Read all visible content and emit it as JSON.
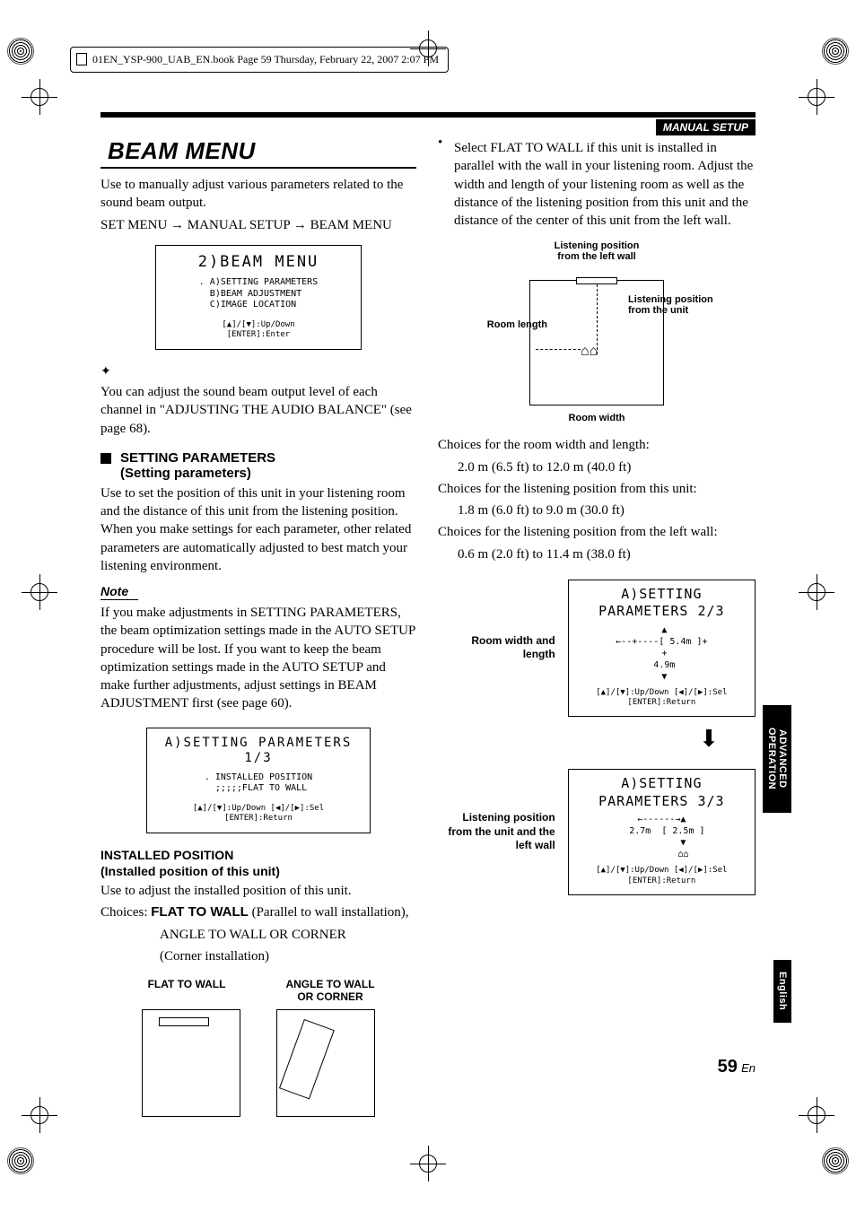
{
  "crop_header": "01EN_YSP-900_UAB_EN.book  Page 59  Thursday, February 22, 2007  2:07 PM",
  "header_right": "MANUAL SETUP",
  "big_title": "BEAM MENU",
  "intro1": "Use to manually adjust various parameters related to the sound beam output.",
  "breadcrumb": "SET MENU → MANUAL SETUP → BEAM MENU",
  "lcd1": {
    "title": "2)BEAM MENU",
    "lines": ". A)SETTING PARAMETERS\n  B)BEAM ADJUSTMENT\n  C)IMAGE LOCATION",
    "hint": "[▲]/[▼]:Up/Down\n[ENTER]:Enter"
  },
  "tip": "You can adjust the sound beam output level of each channel in \"ADJUSTING THE AUDIO BALANCE\" (see page 68).",
  "subhead1_line1": "SETTING PARAMETERS",
  "subhead1_line2": "(Setting parameters)",
  "setting_desc": "Use to set the position of this unit in your listening room and the distance of this unit from the listening position. When you make settings for each parameter, other related parameters are automatically adjusted to best match your listening environment.",
  "note_label": "Note",
  "note_body": "If you make adjustments in SETTING PARAMETERS, the beam optimization settings made in the AUTO SETUP procedure will be lost. If you want to keep the beam optimization settings made in the AUTO SETUP and make further adjustments, adjust settings in BEAM ADJUSTMENT first (see page 60).",
  "lcd2": {
    "title": "A)SETTING PARAMETERS 1/3",
    "lines": ". INSTALLED POSITION\n  ;;;;;FLAT TO WALL",
    "hint": "[▲]/[▼]:Up/Down [◀]/[▶]:Sel\n[ENTER]:Return"
  },
  "installed_head": "INSTALLED POSITION",
  "installed_sub": "(Installed position of this unit)",
  "installed_desc": "Use to adjust the installed position of this unit.",
  "choices_label": "Choices:",
  "choice1": "FLAT TO WALL",
  "choice1_desc": " (Parallel to wall installation),",
  "choice2": "ANGLE TO WALL OR CORNER",
  "choice2_desc": "(Corner installation)",
  "install_label_flat": "FLAT TO WALL",
  "install_label_angle": "ANGLE TO WALL OR CORNER",
  "right_bullet": "Select FLAT TO WALL if this unit is installed in parallel with the wall in your listening room. Adjust the width and length of your listening room as well as the distance of the listening position from this unit and the distance of the center of this unit from the left wall.",
  "room_caption_top": "Listening position\nfrom the left wall",
  "room_caption_left": "Room length",
  "room_caption_right": "Listening position\nfrom the unit",
  "room_caption_bot": "Room width",
  "choices_room": "Choices for the room width and length:",
  "choices_room_val": "2.0 m (6.5 ft) to 12.0 m (40.0 ft)",
  "choices_lp_unit": "Choices for the listening position from this unit:",
  "choices_lp_unit_val": "1.8 m (6.0 ft) to 9.0 m (30.0 ft)",
  "choices_lp_wall": "Choices for the listening position from the left wall:",
  "choices_lp_wall_val": "0.6 m (2.0 ft) to 11.4 m (38.0 ft)",
  "pair1_label": "Room width and length",
  "lcd3": {
    "title": "A)SETTING PARAMETERS 2/3",
    "body": " ▲\n←--+----[ 5.4m ]+\n +\n 4.9m\n ▼",
    "hint": "[▲]/[▼]:Up/Down [◀]/[▶]:Sel\n[ENTER]:Return"
  },
  "pair2_label": "Listening position from the unit and the left wall",
  "lcd4": {
    "title": "A)SETTING PARAMETERS 3/3",
    "body": "←------→▲\n  2.7m  [ 2.5m ]\n        ▼\n        ⌂⌂",
    "hint": "[▲]/[▼]:Up/Down [◀]/[▶]:Sel\n[ENTER]:Return"
  },
  "side_adv": "ADVANCED\nOPERATION",
  "side_eng": "English",
  "page_num": "59",
  "page_lang": "En",
  "chart_data": {
    "type": "table",
    "title": "Setting Parameters value ranges",
    "series": [
      {
        "name": "Room width and length",
        "min_m": 2.0,
        "max_m": 12.0,
        "min_ft": 6.5,
        "max_ft": 40.0
      },
      {
        "name": "Listening position from this unit",
        "min_m": 1.8,
        "max_m": 9.0,
        "min_ft": 6.0,
        "max_ft": 30.0
      },
      {
        "name": "Listening position from the left wall",
        "min_m": 0.6,
        "max_m": 11.4,
        "min_ft": 2.0,
        "max_ft": 38.0
      }
    ],
    "screen_examples": {
      "room_width_m": 5.4,
      "room_length_m": 4.9,
      "lp_left_wall_m": 2.7,
      "lp_from_unit_m": 2.5
    }
  }
}
